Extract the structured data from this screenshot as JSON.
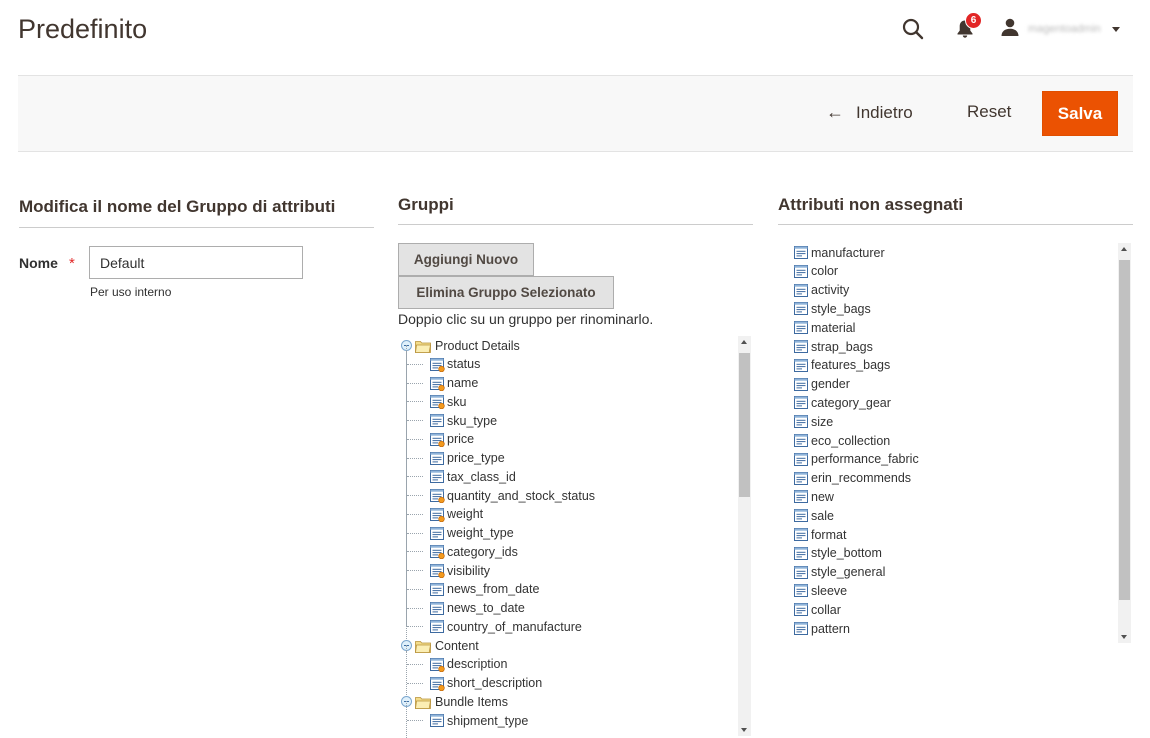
{
  "header": {
    "title": "Predefinito",
    "notification_count": "6",
    "user_name": "magentoadmin"
  },
  "actions": {
    "back_label": "Indietro",
    "reset_label": "Reset",
    "save_label": "Salva",
    "accent_color": "#eb5202"
  },
  "edit_name": {
    "title": "Modifica il nome del Gruppo di attributi",
    "field_label": "Nome",
    "required_mark": "*",
    "field_value": "Default",
    "field_note": "Per uso interno"
  },
  "groups": {
    "title": "Gruppi",
    "add_button": "Aggiungi Nuovo",
    "delete_button": "Elimina Gruppo Selezionato",
    "hint": "Doppio clic su un gruppo per rinominarlo.",
    "tree": [
      {
        "name": "Product Details",
        "attributes": [
          {
            "name": "status",
            "system": true
          },
          {
            "name": "name",
            "system": true
          },
          {
            "name": "sku",
            "system": true
          },
          {
            "name": "sku_type",
            "system": false
          },
          {
            "name": "price",
            "system": true
          },
          {
            "name": "price_type",
            "system": false
          },
          {
            "name": "tax_class_id",
            "system": false
          },
          {
            "name": "quantity_and_stock_status",
            "system": true
          },
          {
            "name": "weight",
            "system": true
          },
          {
            "name": "weight_type",
            "system": false
          },
          {
            "name": "category_ids",
            "system": true
          },
          {
            "name": "visibility",
            "system": true
          },
          {
            "name": "news_from_date",
            "system": false
          },
          {
            "name": "news_to_date",
            "system": false
          },
          {
            "name": "country_of_manufacture",
            "system": false
          }
        ]
      },
      {
        "name": "Content",
        "attributes": [
          {
            "name": "description",
            "system": true
          },
          {
            "name": "short_description",
            "system": true
          }
        ]
      },
      {
        "name": "Bundle Items",
        "attributes": [
          {
            "name": "shipment_type",
            "system": false
          }
        ]
      }
    ]
  },
  "unassigned": {
    "title": "Attributi non assegnati",
    "attributes": [
      "manufacturer",
      "color",
      "activity",
      "style_bags",
      "material",
      "strap_bags",
      "features_bags",
      "gender",
      "category_gear",
      "size",
      "eco_collection",
      "performance_fabric",
      "erin_recommends",
      "new",
      "sale",
      "format",
      "style_bottom",
      "style_general",
      "sleeve",
      "collar",
      "pattern"
    ]
  }
}
